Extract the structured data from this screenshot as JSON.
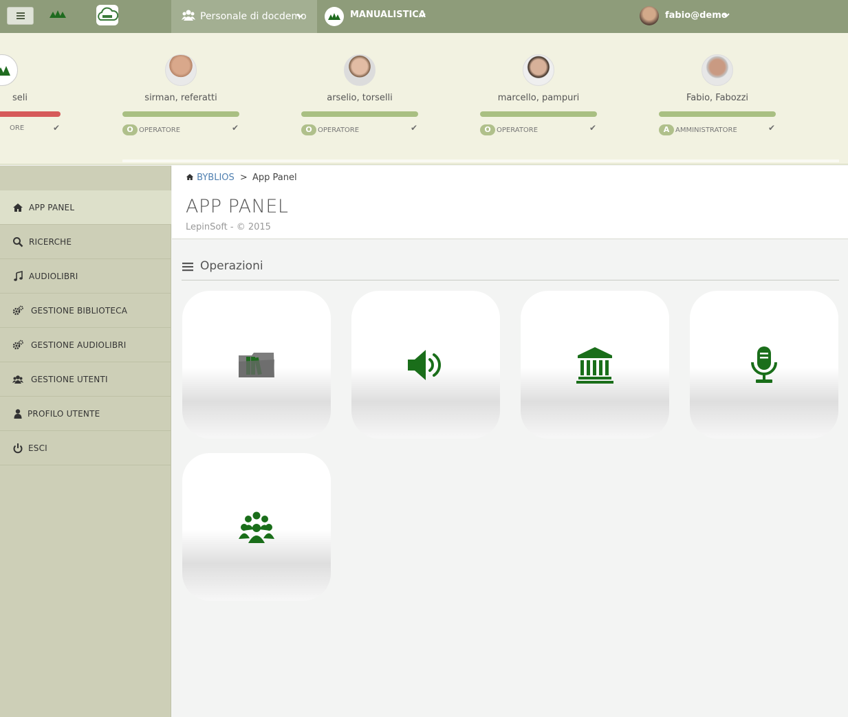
{
  "navbar": {
    "org_label": "Personale di docdemo",
    "manual_label": "MANUALISTICA",
    "user_label": "fabio@demo"
  },
  "users": [
    {
      "name": "seli",
      "role_letter": "",
      "role": "ORE",
      "bar_color": "#d65a5a"
    },
    {
      "name": "sirman, referatti",
      "role_letter": "O",
      "role": "OPERATORE",
      "bar_color": "#a9bf82"
    },
    {
      "name": "arselio, torselli",
      "role_letter": "O",
      "role": "OPERATORE",
      "bar_color": "#a9bf82"
    },
    {
      "name": "marcello, pampuri",
      "role_letter": "O",
      "role": "OPERATORE",
      "bar_color": "#a9bf82"
    },
    {
      "name": "Fabio, Fabozzi",
      "role_letter": "A",
      "role": "AMMINISTRATORE",
      "bar_color": "#a9bf82"
    }
  ],
  "sidebar": {
    "items": [
      {
        "label": "APP PANEL",
        "icon": "home-icon"
      },
      {
        "label": "RICERCHE",
        "icon": "search-icon"
      },
      {
        "label": "AUDIOLIBRI",
        "icon": "music-icon"
      },
      {
        "label": "GESTIONE BIBLIOTECA",
        "icon": "cogs-icon"
      },
      {
        "label": "GESTIONE AUDIOLIBRI",
        "icon": "cogs-icon"
      },
      {
        "label": "GESTIONE UTENTI",
        "icon": "users-icon"
      },
      {
        "label": "PROFILO UTENTE",
        "icon": "user-icon"
      },
      {
        "label": "ESCI",
        "icon": "power-icon"
      }
    ]
  },
  "breadcrumb": {
    "root": "BYBLIOS",
    "current": "App Panel"
  },
  "page": {
    "title": "APP PANEL",
    "subtitle": "LepinSoft - © 2015"
  },
  "section": {
    "title": "Operazioni"
  },
  "tiles": [
    {
      "icon": "library-folder-icon"
    },
    {
      "icon": "volume-icon"
    },
    {
      "icon": "bank-icon"
    },
    {
      "icon": "microphone-icon"
    },
    {
      "icon": "group-icon"
    }
  ],
  "colors": {
    "navbar": "#8e9c7a",
    "sidebar": "#cdcfb7",
    "icon_green": "#1a6e1a",
    "link": "#4f7fb0"
  }
}
